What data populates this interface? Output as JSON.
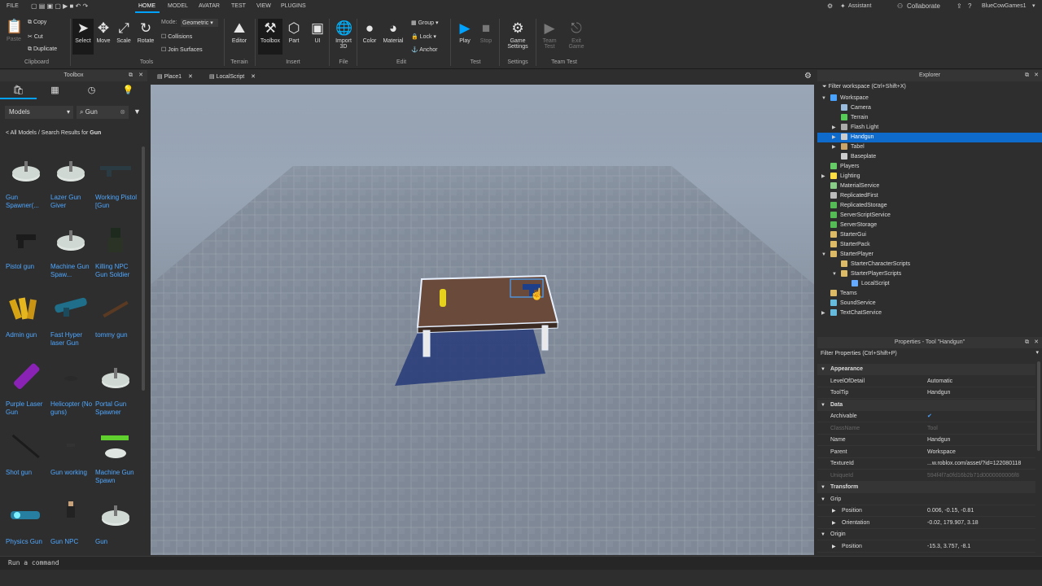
{
  "menubar": {
    "file": "FILE",
    "tabs": [
      "HOME",
      "MODEL",
      "AVATAR",
      "TEST",
      "VIEW",
      "PLUGINS"
    ],
    "assistant": "Assistant",
    "collaborate": "Collaborate",
    "user": "BlueCowGames1"
  },
  "ribbon": {
    "paste": "Paste",
    "copy": "Copy",
    "cut": "Cut",
    "duplicate": "Duplicate",
    "clipboard": "Clipboard",
    "select": "Select",
    "move": "Move",
    "scale": "Scale",
    "rotate": "Rotate",
    "mode_label": "Mode:",
    "mode_value": "Geometric",
    "collisions": "Collisions",
    "join_surfaces": "Join Surfaces",
    "tools": "Tools",
    "editor": "Editor",
    "terrain": "Terrain",
    "toolbox": "Toolbox",
    "part": "Part",
    "ui": "UI",
    "import3d": "Import 3D",
    "insert": "Insert",
    "file": "File",
    "color": "Color",
    "material": "Material",
    "group": "Group",
    "lock": "Lock",
    "anchor": "Anchor",
    "edit": "Edit",
    "play": "Play",
    "stop": "Stop",
    "test": "Test",
    "game_settings": "Game Settings",
    "settings": "Settings",
    "team_test": "Team Test",
    "exit_game": "Exit Game",
    "team_test_group": "Team Test"
  },
  "toolbox": {
    "title": "Toolbox",
    "category": "Models",
    "search_value": "Gun",
    "breadcrumb": "< All Models / Search Results for ",
    "breadcrumb_term": "Gun",
    "items": [
      {
        "label": "Gun Spawner(...",
        "icon": "disc"
      },
      {
        "label": "Lazer Gun Giver",
        "icon": "disc"
      },
      {
        "label": "Working Pistol [Gun",
        "icon": "rifle"
      },
      {
        "label": "Pistol gun",
        "icon": "pistol"
      },
      {
        "label": "Machine Gun Spaw...",
        "icon": "disc"
      },
      {
        "label": "Killing NPC Gun Soldier",
        "icon": "soldier"
      },
      {
        "label": "Admin gun",
        "icon": "gold"
      },
      {
        "label": "Fast Hyper laser Gun",
        "icon": "laser"
      },
      {
        "label": "tommy gun",
        "icon": "tommy"
      },
      {
        "label": "Purple Laser Gun",
        "icon": "purple"
      },
      {
        "label": "Helicopter (No guns)",
        "icon": "heli"
      },
      {
        "label": "Portal Gun Spawner",
        "icon": "disc"
      },
      {
        "label": "Shot gun",
        "icon": "shotgun"
      },
      {
        "label": "Gun working",
        "icon": "dark"
      },
      {
        "label": "Machine Gun Spawn",
        "icon": "green"
      },
      {
        "label": "Physics Gun",
        "icon": "physics"
      },
      {
        "label": "Gun NPC",
        "icon": "npc"
      },
      {
        "label": "Gun",
        "icon": "disc"
      }
    ]
  },
  "tabs": {
    "place": "Place1",
    "script": "LocalScript"
  },
  "explorer": {
    "title": "Explorer",
    "filter": "Filter workspace (Ctrl+Shift+X)",
    "rows": [
      {
        "label": "Workspace",
        "indent": 0,
        "arrow": "open",
        "color": "#4aa3ff"
      },
      {
        "label": "Camera",
        "indent": 1,
        "arrow": "",
        "color": "#9bd"
      },
      {
        "label": "Terrain",
        "indent": 1,
        "arrow": "",
        "color": "#5c5"
      },
      {
        "label": "Flash Light",
        "indent": 1,
        "arrow": "closed",
        "color": "#aaa"
      },
      {
        "label": "Handgun",
        "indent": 1,
        "arrow": "closed",
        "color": "#ccc",
        "selected": true
      },
      {
        "label": "Tabel",
        "indent": 1,
        "arrow": "closed",
        "color": "#caa56a"
      },
      {
        "label": "Baseplate",
        "indent": 1,
        "arrow": "",
        "color": "#ccc"
      },
      {
        "label": "Players",
        "indent": 0,
        "arrow": "",
        "color": "#6c6"
      },
      {
        "label": "Lighting",
        "indent": 0,
        "arrow": "closed",
        "color": "#fd4"
      },
      {
        "label": "MaterialService",
        "indent": 0,
        "arrow": "",
        "color": "#8c8"
      },
      {
        "label": "ReplicatedFirst",
        "indent": 0,
        "arrow": "",
        "color": "#bbb"
      },
      {
        "label": "ReplicatedStorage",
        "indent": 0,
        "arrow": "",
        "color": "#5b5"
      },
      {
        "label": "ServerScriptService",
        "indent": 0,
        "arrow": "",
        "color": "#5b5"
      },
      {
        "label": "ServerStorage",
        "indent": 0,
        "arrow": "",
        "color": "#5b5"
      },
      {
        "label": "StarterGui",
        "indent": 0,
        "arrow": "",
        "color": "#db6"
      },
      {
        "label": "StarterPack",
        "indent": 0,
        "arrow": "",
        "color": "#db6"
      },
      {
        "label": "StarterPlayer",
        "indent": 0,
        "arrow": "open",
        "color": "#db6"
      },
      {
        "label": "StarterCharacterScripts",
        "indent": 1,
        "arrow": "",
        "color": "#db6"
      },
      {
        "label": "StarterPlayerScripts",
        "indent": 1,
        "arrow": "open",
        "color": "#db6"
      },
      {
        "label": "LocalScript",
        "indent": 2,
        "arrow": "",
        "color": "#6af"
      },
      {
        "label": "Teams",
        "indent": 0,
        "arrow": "",
        "color": "#db6"
      },
      {
        "label": "SoundService",
        "indent": 0,
        "arrow": "",
        "color": "#6bd"
      },
      {
        "label": "TextChatService",
        "indent": 0,
        "arrow": "closed",
        "color": "#6bd"
      }
    ]
  },
  "properties": {
    "title": "Properties - Tool \"Handgun\"",
    "filter": "Filter Properties (Ctrl+Shift+P)",
    "rows": [
      {
        "type": "section",
        "name": "Appearance"
      },
      {
        "type": "prop",
        "name": "LevelOfDetail",
        "value": "Automatic"
      },
      {
        "type": "prop",
        "name": "ToolTip",
        "value": "Handgun"
      },
      {
        "type": "section",
        "name": "Data"
      },
      {
        "type": "prop",
        "name": "Archivable",
        "value": "✔"
      },
      {
        "type": "prop",
        "name": "ClassName",
        "value": "Tool",
        "dim": true
      },
      {
        "type": "prop",
        "name": "Name",
        "value": "Handgun"
      },
      {
        "type": "prop",
        "name": "Parent",
        "value": "Workspace"
      },
      {
        "type": "prop",
        "name": "TextureId",
        "value": "...w.roblox.com/asset/?id=122080118"
      },
      {
        "type": "prop",
        "name": "UniqueId",
        "value": "594f4f7a0fd16b2b71d0000000006f8",
        "dim": true
      },
      {
        "type": "section",
        "name": "Transform"
      },
      {
        "type": "sub",
        "name": "Grip",
        "value": ""
      },
      {
        "type": "prop2",
        "name": "Position",
        "value": "0.006, -0.15, -0.81"
      },
      {
        "type": "prop2",
        "name": "Orientation",
        "value": "-0.02, 179.907, 3.18"
      },
      {
        "type": "sub",
        "name": "Origin",
        "value": ""
      },
      {
        "type": "prop2",
        "name": "Position",
        "value": "-15.3, 3.757, -8.1"
      }
    ]
  },
  "command": {
    "placeholder": "Run a command"
  }
}
